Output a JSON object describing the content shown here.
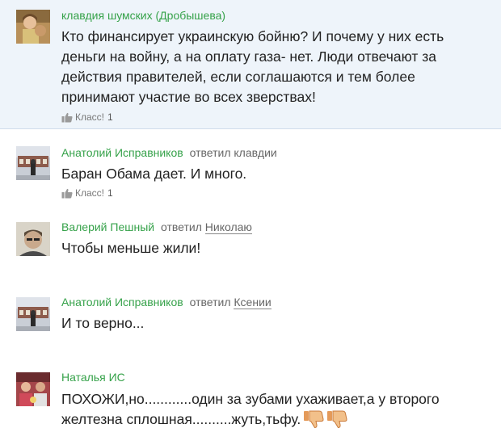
{
  "comments": [
    {
      "author": "клавдия шумских (Дробышева)",
      "reply_verb": "",
      "reply_to": "",
      "text": "Кто финансирует украинскую бойню? И почему у них есть деньги на войну, а на оплату газа- нет. Люди отвечают за действия правителей, если соглашаются и тем более принимают участие во всех зверствах!",
      "like_label": "Класс!",
      "like_count": "1"
    },
    {
      "author": "Анатолий Исправников",
      "reply_verb": "ответил",
      "reply_to": "клавдии",
      "text": "Баран  Обама дает.  И много.",
      "like_label": "Класс!",
      "like_count": "1"
    },
    {
      "author": "Валерий Пешный",
      "reply_verb": "ответил",
      "reply_to": "Николаю",
      "text": "Чтобы меньше жили!"
    },
    {
      "author": "Анатолий Исправников",
      "reply_verb": "ответил",
      "reply_to": "Ксении",
      "text": "И то верно..."
    },
    {
      "author": "Наталья ИС",
      "reply_verb": "",
      "reply_to": "",
      "text": "ПОХОЖИ,но............один за зубами ухаживает,а у второго желтезна сплошная..........жуть,тьфу.",
      "emojis": [
        "thumbs-down-emoji",
        "thumbs-down-emoji"
      ]
    }
  ],
  "colors": {
    "author": "#36a24a",
    "highlight_bg": "#eef4fa",
    "text": "#222222",
    "muted": "#666666"
  }
}
